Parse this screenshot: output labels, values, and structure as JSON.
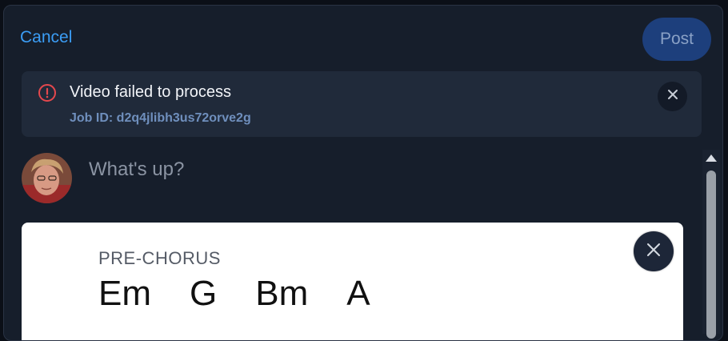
{
  "header": {
    "cancel_label": "Cancel",
    "post_label": "Post"
  },
  "alert": {
    "title": "Video failed to process",
    "job_id": "Job ID: d2q4jlibh3us72orve2g",
    "icon": "info-circle-icon",
    "close_icon": "close-icon"
  },
  "composer": {
    "placeholder": "What's up?"
  },
  "card": {
    "section_label": "PRE-CHORUS",
    "chords": [
      "Em",
      "G",
      "Bm",
      "A"
    ]
  },
  "colors": {
    "accent": "#3b9df5",
    "post_button": "#1d3f7c",
    "error": "#e5484d",
    "background": "#161e2b"
  }
}
